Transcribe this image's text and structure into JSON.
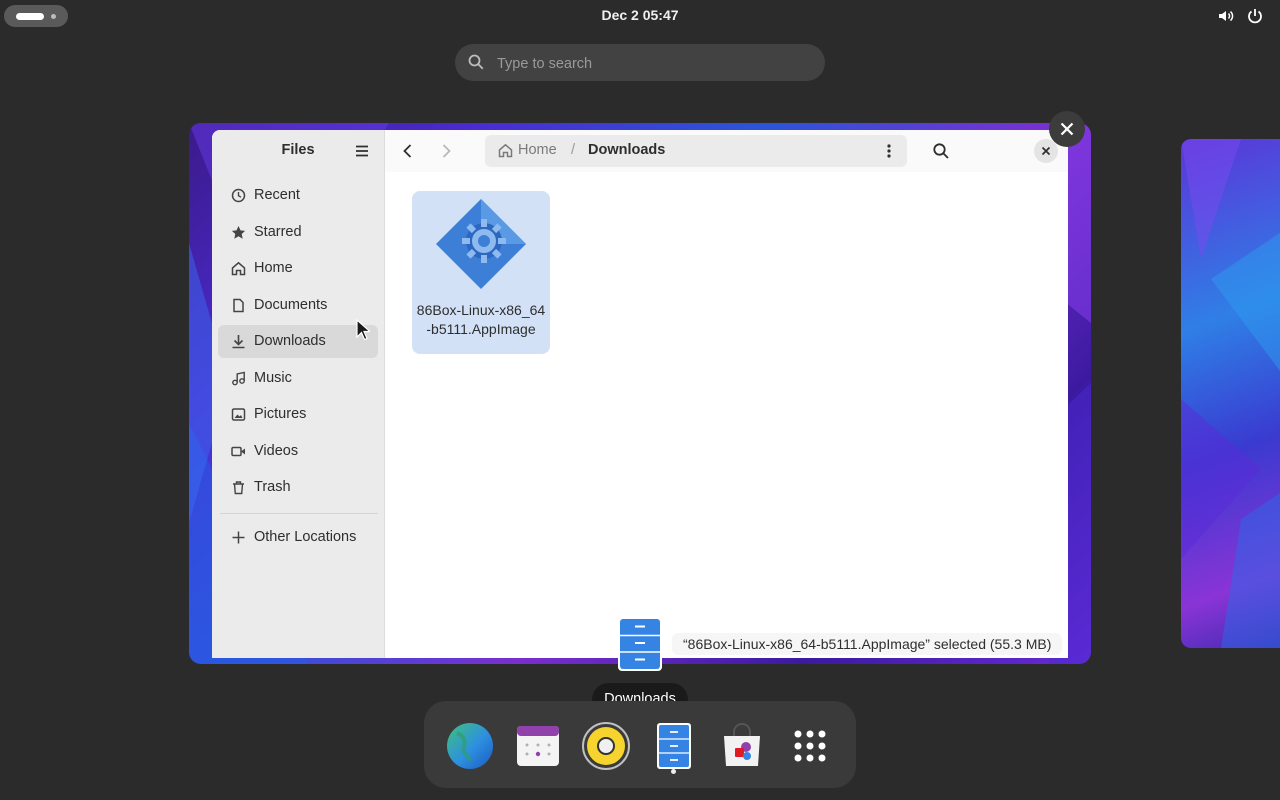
{
  "topbar": {
    "clock": "Dec 2  05:47"
  },
  "search": {
    "placeholder": "Type to search"
  },
  "files_window": {
    "app_title": "Files",
    "sidebar": {
      "items": [
        {
          "label": "Recent",
          "icon": "clock-icon"
        },
        {
          "label": "Starred",
          "icon": "star-icon"
        },
        {
          "label": "Home",
          "icon": "home-icon"
        },
        {
          "label": "Documents",
          "icon": "document-icon"
        },
        {
          "label": "Downloads",
          "icon": "download-icon",
          "active": true
        },
        {
          "label": "Music",
          "icon": "music-icon"
        },
        {
          "label": "Pictures",
          "icon": "picture-icon"
        },
        {
          "label": "Videos",
          "icon": "video-icon"
        },
        {
          "label": "Trash",
          "icon": "trash-icon"
        }
      ],
      "other_locations": "Other Locations"
    },
    "path": {
      "home": "Home",
      "separator": "/",
      "current": "Downloads"
    },
    "files": [
      {
        "name": "86Box-Linux-x86_64-b5111.AppImage",
        "selected": true
      }
    ],
    "status": "“86Box-Linux-x86_64-b5111.AppImage” selected  (55.3 MB)"
  },
  "dock": {
    "tooltip": "Downloads",
    "apps": [
      "web-browser-icon",
      "calendar-icon",
      "music-player-icon",
      "files-icon",
      "software-store-icon",
      "app-grid-icon"
    ],
    "accent": "#3584e4"
  }
}
